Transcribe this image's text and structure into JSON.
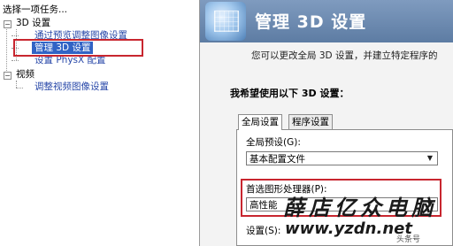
{
  "left_panel": {
    "title": "选择一项任务...",
    "tree": [
      {
        "label": "3D 设置",
        "expander": "−",
        "children": [
          {
            "label": "通过预览调整图像设置",
            "selected": false
          },
          {
            "label": "管理 3D 设置",
            "selected": true
          },
          {
            "label": "设置 PhysX 配置",
            "selected": false
          }
        ]
      },
      {
        "label": "视频",
        "expander": "−",
        "children": [
          {
            "label": "调整视频图像设置",
            "selected": false
          }
        ]
      }
    ]
  },
  "header": {
    "title": "管理 3D 设置"
  },
  "description": "您可以更改全局 3D 设置，并建立特定程序的",
  "section_title": "我希望使用以下 3D 设置：",
  "tabs": [
    {
      "label": "全局设置",
      "active": true
    },
    {
      "label": "程序设置",
      "active": false
    }
  ],
  "global_preset": {
    "label": "全局预设(G):",
    "value": "基本配置文件"
  },
  "preferred_gpu": {
    "label": "首选图形处理器(P):",
    "value": "高性能"
  },
  "settings_label": "设置(S):",
  "watermark": {
    "brand": "薛店亿众电脑",
    "url": "www.yzdn.net",
    "tag": "头条号"
  },
  "colors": {
    "selection": "#3163c5",
    "highlight_border": "#c8262f",
    "header_bg": "#6b89b0"
  },
  "icons": {
    "header": "3d-settings-cube-icon",
    "dropdown": "chevron-down-icon"
  }
}
